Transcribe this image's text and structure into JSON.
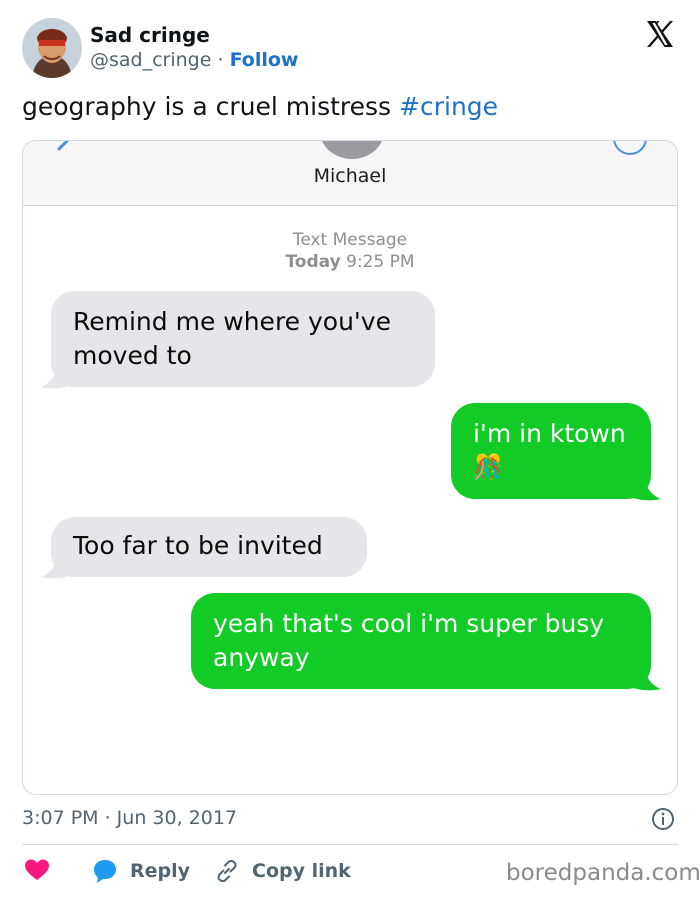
{
  "tweet": {
    "display_name": "Sad cringe",
    "handle": "@sad_cringe",
    "separator": " · ",
    "follow_label": "Follow",
    "text": "geography is a cruel mistress",
    "hashtag": "#cringe",
    "timestamp": "3:07 PM · Jun 30, 2017"
  },
  "actions": {
    "reply_label": "Reply",
    "copy_link_label": "Copy link"
  },
  "screenshot": {
    "contact_name": "Michael",
    "meta_line1": "Text Message",
    "meta_day": "Today",
    "meta_time": "9:25 PM",
    "messages": [
      {
        "direction": "incoming",
        "text_line1": "Remind me where you've",
        "text_line2": "moved to"
      },
      {
        "direction": "outgoing",
        "text_line1": "i'm in ktown",
        "emoji": "🎊"
      },
      {
        "direction": "incoming",
        "text_line1": "Too far to be invited"
      },
      {
        "direction": "outgoing",
        "text_line1": "yeah that's cool i'm super busy",
        "text_line2": "anyway"
      }
    ]
  },
  "watermark": "boredpanda.com",
  "colors": {
    "link_blue": "#1d72c7",
    "imessage_green": "#12cb27",
    "incoming_gray": "#e5e5ea",
    "like_pink": "#f91880"
  },
  "icons": {
    "x_logo": "x-logo-icon",
    "heart": "heart-icon",
    "reply": "speech-bubble-icon",
    "copy_link": "link-icon",
    "info": "info-icon"
  }
}
